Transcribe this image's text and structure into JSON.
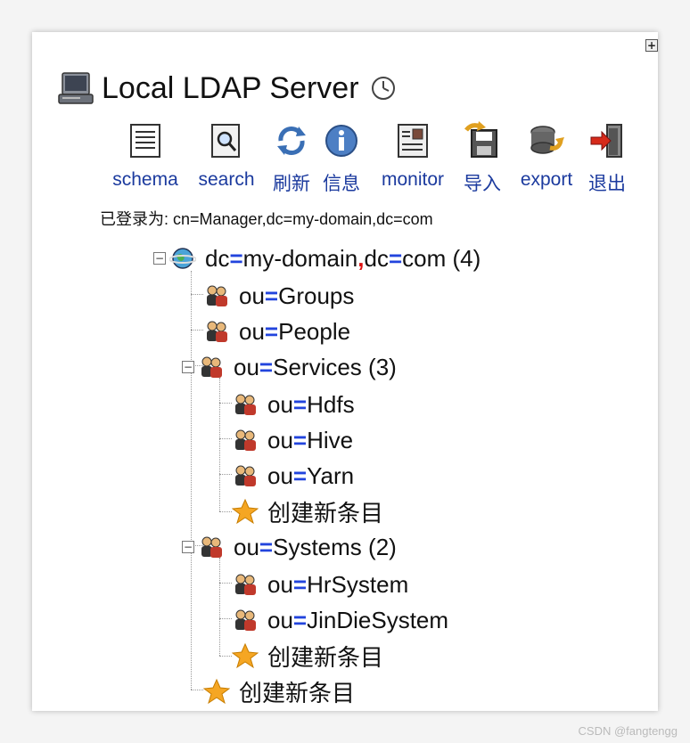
{
  "server": {
    "title": "Local LDAP Server"
  },
  "toolbar": [
    {
      "label": "schema",
      "icon": "schema-icon"
    },
    {
      "label": "search",
      "icon": "search-icon"
    },
    {
      "label": "刷新",
      "icon": "refresh-icon"
    },
    {
      "label": "信息",
      "icon": "info-icon"
    },
    {
      "label": "monitor",
      "icon": "monitor-icon"
    },
    {
      "label": "导入",
      "icon": "import-icon"
    },
    {
      "label": "export",
      "icon": "export-icon"
    },
    {
      "label": "退出",
      "icon": "logout-icon"
    }
  ],
  "login": {
    "text": "已登录为: cn=Manager,dc=my-domain,dc=com"
  },
  "tree": {
    "root": {
      "a": "dc",
      "b": "my-domain",
      "c": "dc",
      "d": "com",
      "count": "(4)"
    },
    "groups": {
      "attr": "ou",
      "value": "Groups"
    },
    "people": {
      "attr": "ou",
      "value": "People"
    },
    "services": {
      "attr": "ou",
      "value": "Services",
      "count": "(3)"
    },
    "hdfs": {
      "attr": "ou",
      "value": "Hdfs"
    },
    "hive": {
      "attr": "ou",
      "value": "Hive"
    },
    "yarn": {
      "attr": "ou",
      "value": "Yarn"
    },
    "services_create": "创建新条目",
    "systems": {
      "attr": "ou",
      "value": "Systems",
      "count": "(2)"
    },
    "hrsystem": {
      "attr": "ou",
      "value": "HrSystem"
    },
    "jindie": {
      "attr": "ou",
      "value": "JinDieSystem"
    },
    "systems_create": "创建新条目",
    "root_create": "创建新条目"
  },
  "watermark": "CSDN @fangtengg",
  "colors": {
    "link": "#1b3a9e",
    "equals": "#2244dd",
    "comma": "#dd1111"
  }
}
